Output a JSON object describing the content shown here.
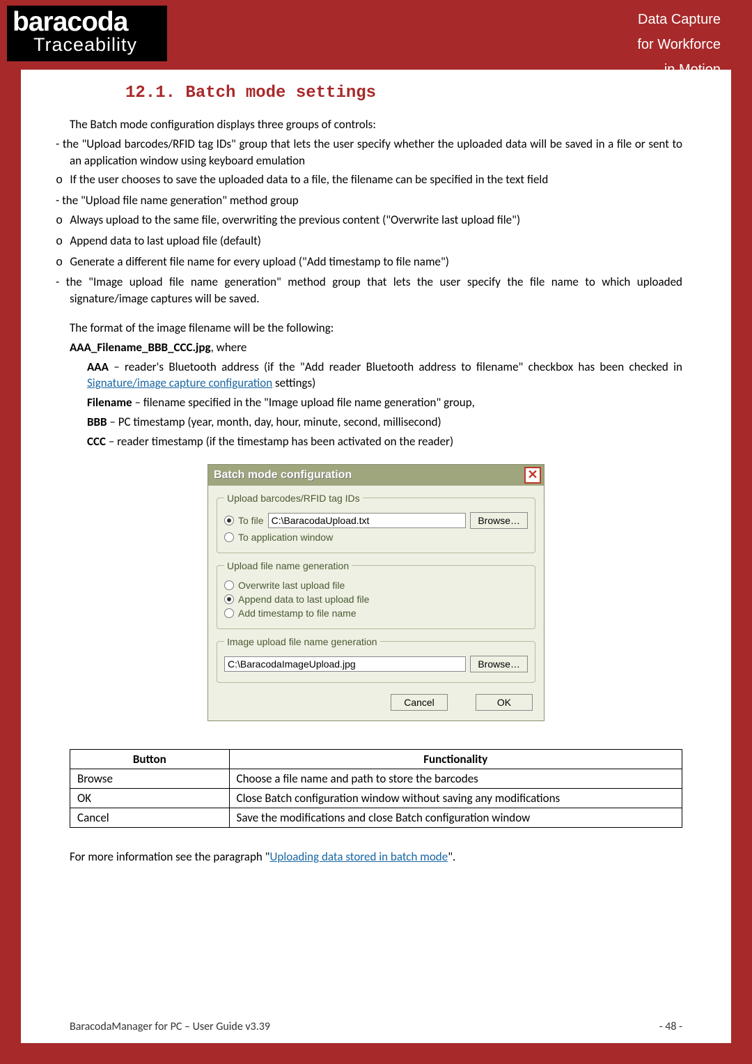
{
  "header": {
    "logo_line1": "baracoda",
    "logo_line2": "Traceability",
    "tagline1": "Data Capture",
    "tagline2": "for Workforce",
    "tagline3": "in Motion"
  },
  "section_title": "12.1.  Batch mode settings",
  "intro_line": "The Batch mode configuration displays three groups of controls:",
  "b1": "the \"Upload barcodes/RFID tag IDs\" group that lets the user specify whether the uploaded data will be saved in a file or sent to an application window using keyboard emulation",
  "b1s1": "If the user chooses to save the uploaded data to a file, the filename can be specified in the text field",
  "b2": "the \"Upload file name generation\" method group",
  "b2s1": "Always upload to the same file, overwriting the previous content (\"Overwrite last upload file\")",
  "b2s2": "Append data to last upload file (default)",
  "b2s3": "Generate a different file name for every upload (\"Add timestamp to file name\")",
  "b3": "the \"Image upload file name generation\" method group that lets the user specify the file name to which uploaded signature/image captures will be saved.",
  "format_intro": "The format of the image filename will be the following:",
  "format_bold": "AAA_Filename_BBB_CCC.jpg",
  "format_where": ", where",
  "aaa_label": "AAA",
  "aaa_text": " – reader's Bluetooth address (if the \"Add reader Bluetooth address to filename\" checkbox has been checked in ",
  "aaa_link": "Signature/image capture configuration",
  "aaa_after": " settings)",
  "filename_label": "Filename",
  "filename_text": " – filename specified in the \"Image upload file name generation\" group,",
  "bbb_label": "BBB",
  "bbb_text": " – PC timestamp (year, month, day, hour, minute, second, millisecond)",
  "ccc_label": "CCC",
  "ccc_text": " – reader timestamp (if the timestamp has been activated on the reader)",
  "dialog": {
    "title": "Batch mode configuration",
    "close": "✕",
    "group1_legend": "Upload barcodes/RFID tag IDs",
    "radio_tofile": "To file",
    "file_path": "C:\\BaracodaUpload.txt",
    "browse": "Browse…",
    "radio_toapp": "To application window",
    "group2_legend": "Upload file name generation",
    "radio_overwrite": "Overwrite last upload file",
    "radio_append": "Append data to last upload file",
    "radio_timestamp": "Add timestamp to file name",
    "group3_legend": "Image upload file name generation",
    "image_path": "C:\\BaracodaImageUpload.jpg",
    "browse2": "Browse…",
    "cancel": "Cancel",
    "ok": "OK"
  },
  "table": {
    "h1": "Button",
    "h2": "Functionality",
    "r1c1": "Browse",
    "r1c2": "Choose a file name and path to store the barcodes",
    "r2c1": "OK",
    "r2c2": "Close Batch configuration window without saving any modifications",
    "r3c1": "Cancel",
    "r3c2": "Save the modifications and close Batch configuration window"
  },
  "more_info_pre": "For more information see the paragraph \"",
  "more_info_link": "Uploading data stored in batch mode",
  "more_info_post": "\".",
  "footer_left": "BaracodaManager for PC – User Guide v3.39",
  "footer_right": "- 48 -"
}
